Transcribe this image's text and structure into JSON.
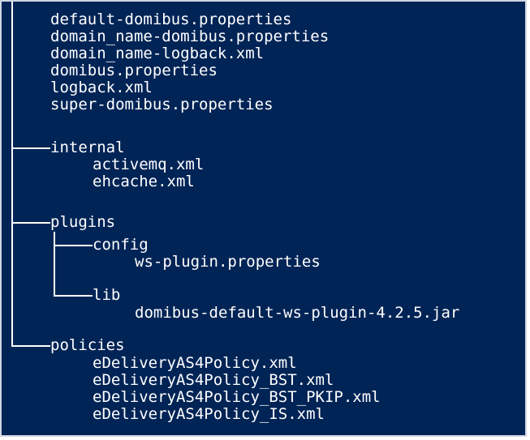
{
  "tree": {
    "root_files": [
      "default-domibus.properties",
      "domain_name-domibus.properties",
      "domain_name-logback.xml",
      "domibus.properties",
      "logback.xml",
      "super-domibus.properties"
    ],
    "internal": {
      "name": "internal",
      "files": [
        "activemq.xml",
        "ehcache.xml"
      ]
    },
    "plugins": {
      "name": "plugins",
      "config": {
        "name": "config",
        "files": [
          "ws-plugin.properties"
        ]
      },
      "lib": {
        "name": "lib",
        "files": [
          "domibus-default-ws-plugin-4.2.5.jar"
        ]
      }
    },
    "policies": {
      "name": "policies",
      "files": [
        "eDeliveryAS4Policy.xml",
        "eDeliveryAS4Policy_BST.xml",
        "eDeliveryAS4Policy_BST_PKIP.xml",
        "eDeliveryAS4Policy_IS.xml"
      ]
    }
  },
  "colors": {
    "background": "#012456",
    "text": "#ffffff"
  }
}
